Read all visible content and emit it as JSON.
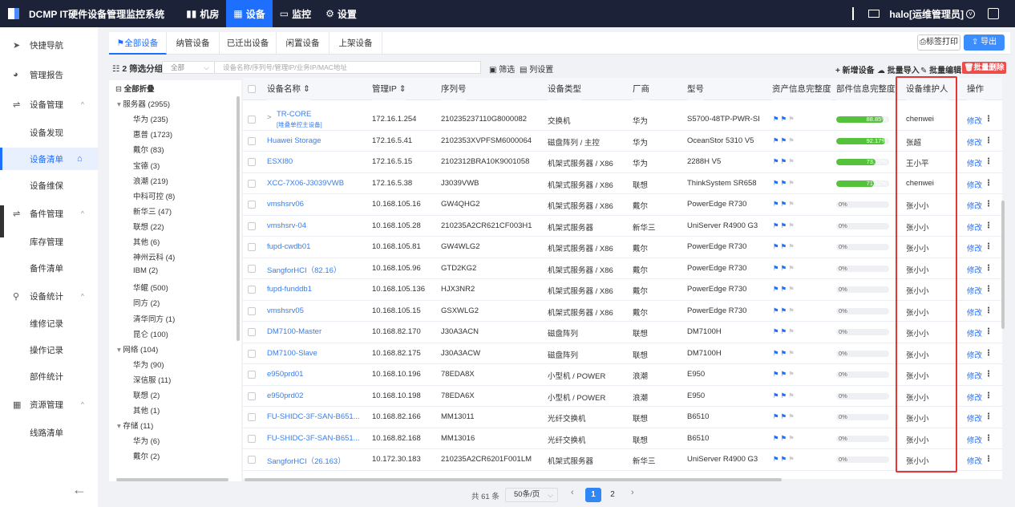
{
  "app": {
    "title": "DCMP IT硬件设备管理监控系统",
    "user": "halo[运维管理员]"
  },
  "topnav": [
    {
      "label": "机房",
      "icon": "bar-chart-icon"
    },
    {
      "label": "设备",
      "icon": "grid-icon"
    },
    {
      "label": "监控",
      "icon": "monitor-icon"
    },
    {
      "label": "设置",
      "icon": "gear-icon"
    }
  ],
  "sidebar": {
    "items": [
      {
        "label": "快捷导航",
        "icon": "➤",
        "chevron": ""
      },
      {
        "label": "管理报告",
        "icon": "◕",
        "chevron": ""
      },
      {
        "label": "设备管理",
        "icon": "⇌",
        "chevron": "^"
      },
      {
        "label": "设备发现",
        "icon": "",
        "chevron": ""
      },
      {
        "label": "设备清单",
        "icon": "",
        "chevron": ""
      },
      {
        "label": "设备维保",
        "icon": "",
        "chevron": ""
      },
      {
        "label": "备件管理",
        "icon": "⇌",
        "chevron": "^"
      },
      {
        "label": "库存管理",
        "icon": "",
        "chevron": ""
      },
      {
        "label": "备件清单",
        "icon": "",
        "chevron": ""
      },
      {
        "label": "设备统计",
        "icon": "⚲",
        "chevron": "^"
      },
      {
        "label": "维修记录",
        "icon": "",
        "chevron": ""
      },
      {
        "label": "操作记录",
        "icon": "",
        "chevron": ""
      },
      {
        "label": "部件统计",
        "icon": "",
        "chevron": ""
      },
      {
        "label": "资源管理",
        "icon": "▦",
        "chevron": "^"
      },
      {
        "label": "线路清单",
        "icon": "",
        "chevron": ""
      }
    ],
    "back": "←"
  },
  "tabs": [
    "全部设备",
    "纳管设备",
    "已迁出设备",
    "闲置设备",
    "上架设备"
  ],
  "buttons": {
    "print": "标签打印",
    "export": "导出",
    "add": "新增设备",
    "import": "批量导入",
    "edit": "批量编辑",
    "delete": "批量删除",
    "filter": "筛选",
    "columns": "列设置"
  },
  "filter": {
    "group": "2 筛选分组",
    "select": "全部",
    "placeholder": "设备名称/序列号/管理IP/业务IP/MAC地址"
  },
  "tree": [
    {
      "label": "全部折叠",
      "level": 0
    },
    {
      "label": "服务器 (2955)",
      "level": 1
    },
    {
      "label": "华为 (235)",
      "level": 2
    },
    {
      "label": "惠普 (1723)",
      "level": 2
    },
    {
      "label": "戴尔 (83)",
      "level": 2
    },
    {
      "label": "宝德 (3)",
      "level": 2
    },
    {
      "label": "浪潮 (219)",
      "level": 2
    },
    {
      "label": "中科可控 (8)",
      "level": 2
    },
    {
      "label": "新华三 (47)",
      "level": 2
    },
    {
      "label": "联想 (22)",
      "level": 2
    },
    {
      "label": "其他 (6)",
      "level": 2
    },
    {
      "label": "神州云科 (4)",
      "level": 2
    },
    {
      "label": "IBM (2)",
      "level": 2
    },
    {
      "label": "华鲲 (500)",
      "level": 2
    },
    {
      "label": "同方 (2)",
      "level": 2
    },
    {
      "label": "清华同方 (1)",
      "level": 2
    },
    {
      "label": "昆仑 (100)",
      "level": 2
    },
    {
      "label": "网络 (104)",
      "level": 1
    },
    {
      "label": "华为 (90)",
      "level": 2
    },
    {
      "label": "深信服 (11)",
      "level": 2
    },
    {
      "label": "联想 (2)",
      "level": 2
    },
    {
      "label": "其他 (1)",
      "level": 2
    },
    {
      "label": "存储 (11)",
      "level": 1
    },
    {
      "label": "华为 (6)",
      "level": 2
    },
    {
      "label": "戴尔 (2)",
      "level": 2
    }
  ],
  "columns": [
    "设备名称",
    "管理IP",
    "序列号",
    "设备类型",
    "厂商",
    "型号",
    "资产信息完整度",
    "部件信息完整度",
    "设备维护人",
    "操作"
  ],
  "rows": [
    {
      "name": "TR-CORE",
      "sub": "[堆叠单控主设备]",
      "ip": "172.16.1.254",
      "sn": "210235237110G8000082",
      "type": "交换机",
      "vendor": "华为",
      "model": "S5700-48TP-PWR-SI",
      "completeness": 88.85,
      "completeness_label": "88.85%",
      "owner": "chenwei",
      "expand": ">"
    },
    {
      "name": "Huawei Storage",
      "ip": "172.16.5.41",
      "sn": "2102353XVPFSM6000064",
      "type": "磁盘阵列 / 主控",
      "vendor": "华为",
      "model": "OceanStor 5310 V5",
      "completeness": 92.17,
      "completeness_label": "92.17%",
      "owner": "张超"
    },
    {
      "name": "ESXI80",
      "ip": "172.16.5.15",
      "sn": "2102312BRA10K9001058",
      "type": "机架式服务器 / X86",
      "vendor": "华为",
      "model": "2288H V5",
      "completeness": 73.73,
      "completeness_label": "73.73%",
      "owner": "王小平"
    },
    {
      "name": "XCC-7X06-J3039VWB",
      "ip": "172.16.5.38",
      "sn": "J3039VWB",
      "type": "机架式服务器 / X86",
      "vendor": "联想",
      "model": "ThinkSystem SR658",
      "completeness": 71.52,
      "completeness_label": "71.52%",
      "owner": "chenwei"
    },
    {
      "name": "vmshsrv06",
      "ip": "10.168.105.16",
      "sn": "GW4QHG2",
      "type": "机架式服务器 / X86",
      "vendor": "戴尔",
      "model": "PowerEdge R730",
      "completeness": 0,
      "completeness_label": "0%",
      "owner": "张小小"
    },
    {
      "name": "vmshsrv-04",
      "ip": "10.168.105.28",
      "sn": "210235A2CR621CF003H1",
      "type": "机架式服务器",
      "vendor": "新华三",
      "model": "UniServer R4900 G3",
      "completeness": 0,
      "completeness_label": "0%",
      "owner": "张小小"
    },
    {
      "name": "fupd-cwdb01",
      "ip": "10.168.105.81",
      "sn": "GW4WLG2",
      "type": "机架式服务器 / X86",
      "vendor": "戴尔",
      "model": "PowerEdge R730",
      "completeness": 0,
      "completeness_label": "0%",
      "owner": "张小小"
    },
    {
      "name": "SangforHCI（82.16）",
      "ip": "10.168.105.96",
      "sn": "GTD2KG2",
      "type": "机架式服务器 / X86",
      "vendor": "戴尔",
      "model": "PowerEdge R730",
      "completeness": 0,
      "completeness_label": "0%",
      "owner": "张小小"
    },
    {
      "name": "fupd-funddb1",
      "ip": "10.168.105.136",
      "sn": "HJX3NR2",
      "type": "机架式服务器 / X86",
      "vendor": "戴尔",
      "model": "PowerEdge R730",
      "completeness": 0,
      "completeness_label": "0%",
      "owner": "张小小"
    },
    {
      "name": "vmshsrv05",
      "ip": "10.168.105.15",
      "sn": "GSXWLG2",
      "type": "机架式服务器 / X86",
      "vendor": "戴尔",
      "model": "PowerEdge R730",
      "completeness": 0,
      "completeness_label": "0%",
      "owner": "张小小"
    },
    {
      "name": "DM7100-Master",
      "ip": "10.168.82.170",
      "sn": "J30A3ACN",
      "type": "磁盘阵列",
      "vendor": "联想",
      "model": "DM7100H",
      "completeness": 0,
      "completeness_label": "0%",
      "owner": "张小小"
    },
    {
      "name": "DM7100-Slave",
      "ip": "10.168.82.175",
      "sn": "J30A3ACW",
      "type": "磁盘阵列",
      "vendor": "联想",
      "model": "DM7100H",
      "completeness": 0,
      "completeness_label": "0%",
      "owner": "张小小"
    },
    {
      "name": "e950prd01",
      "ip": "10.168.10.196",
      "sn": "78EDA8X",
      "type": "小型机 / POWER",
      "vendor": "浪潮",
      "model": "E950",
      "completeness": 0,
      "completeness_label": "0%",
      "owner": "张小小"
    },
    {
      "name": "e950prd02",
      "ip": "10.168.10.198",
      "sn": "78EDA6X",
      "type": "小型机 / POWER",
      "vendor": "浪潮",
      "model": "E950",
      "completeness": 0,
      "completeness_label": "0%",
      "owner": "张小小"
    },
    {
      "name": "FU-SHIDC-3F-SAN-B651...",
      "ip": "10.168.82.166",
      "sn": "MM13011",
      "type": "光纤交换机",
      "vendor": "联想",
      "model": "B6510",
      "completeness": 0,
      "completeness_label": "0%",
      "owner": "张小小"
    },
    {
      "name": "FU-SHIDC-3F-SAN-B651...",
      "ip": "10.168.82.168",
      "sn": "MM13016",
      "type": "光纤交换机",
      "vendor": "联想",
      "model": "B6510",
      "completeness": 0,
      "completeness_label": "0%",
      "owner": "张小小"
    },
    {
      "name": "SangforHCI（26.163）",
      "ip": "10.172.30.183",
      "sn": "210235A2CR6201F001LM",
      "type": "机架式服务器",
      "vendor": "新华三",
      "model": "UniServer R4900 G3",
      "completeness": 0,
      "completeness_label": "0%",
      "owner": "张小小"
    }
  ],
  "row_action": "修改",
  "pager": {
    "total": "共 61 条",
    "size": "50条/页",
    "pages": [
      "1",
      "2"
    ],
    "current": "1",
    "prev": "‹",
    "next": "›"
  },
  "colors": {
    "topbar": "#1c2237",
    "accent": "#1f6fff",
    "progress": "#55c23b",
    "danger": "#f04b4b",
    "highlight": "#e63535"
  }
}
